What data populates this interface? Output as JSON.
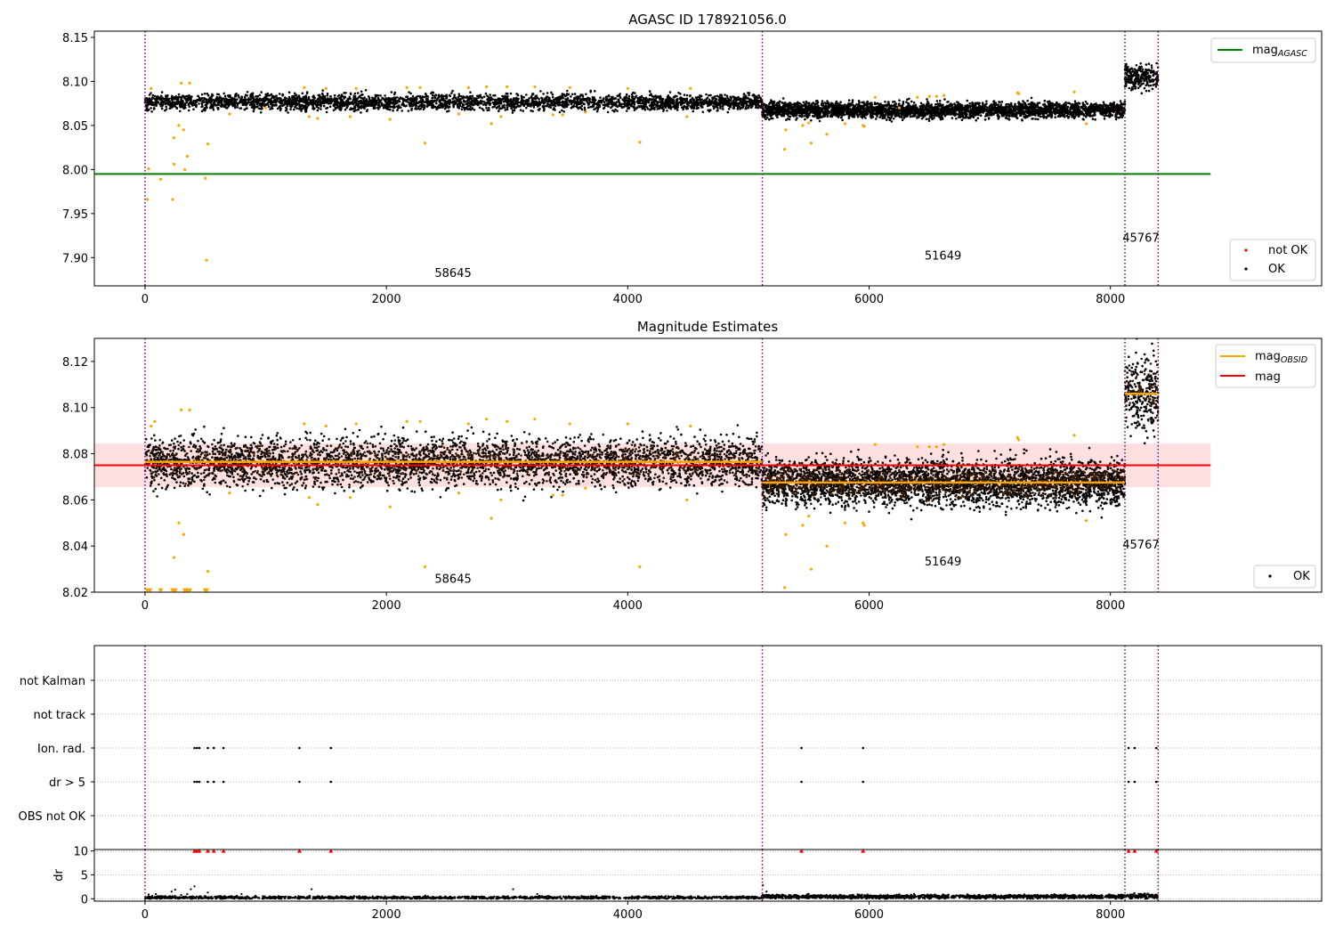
{
  "chart_data": [
    {
      "id": "agasc",
      "type": "scatter",
      "title": "AGASC ID 178921056.0",
      "xlim": [
        -420,
        9750
      ],
      "ylim": [
        7.868,
        8.157
      ],
      "xticks": [
        0,
        2000,
        4000,
        6000,
        8000
      ],
      "xtick_labels": [
        "0",
        "2000",
        "4000",
        "6000",
        "8000"
      ],
      "yticks": [
        7.9,
        7.95,
        8.0,
        8.05,
        8.1,
        8.15
      ],
      "ytick_labels": [
        "7.90",
        "7.95",
        "8.00",
        "8.05",
        "8.10",
        "8.15"
      ],
      "vlines": [
        0,
        5115,
        8120,
        8395
      ],
      "hline": {
        "y": 7.995,
        "x_range": [
          -420,
          8830
        ],
        "color": "#008000"
      },
      "obsid_labels": [
        {
          "text": "58645",
          "x": 2400,
          "y": 7.878
        },
        {
          "text": "51649",
          "x": 6460,
          "y": 7.898
        },
        {
          "text": "45767",
          "x": 8100,
          "y": 7.918
        }
      ],
      "segments": [
        {
          "x0": 0,
          "x1": 5115,
          "mean": 8.0765,
          "spread": 0.0045
        },
        {
          "x0": 5115,
          "x1": 8120,
          "mean": 8.0675,
          "spread": 0.0045
        },
        {
          "x0": 8120,
          "x1": 8395,
          "mean": 8.105,
          "spread": 0.007
        }
      ],
      "outliers": [
        [
          20,
          7.966
        ],
        [
          30,
          8.001
        ],
        [
          50,
          8.092
        ],
        [
          130,
          7.989
        ],
        [
          230,
          7.966
        ],
        [
          240,
          8.006
        ],
        [
          240,
          8.036
        ],
        [
          280,
          8.05
        ],
        [
          300,
          8.098
        ],
        [
          320,
          8.045
        ],
        [
          330,
          8.0
        ],
        [
          350,
          8.015
        ],
        [
          370,
          8.098
        ],
        [
          500,
          7.99
        ],
        [
          510,
          7.897
        ],
        [
          520,
          8.029
        ],
        [
          700,
          8.063
        ],
        [
          1000,
          8.07
        ],
        [
          1320,
          8.093
        ],
        [
          1360,
          8.06
        ],
        [
          1430,
          8.058
        ],
        [
          1500,
          8.092
        ],
        [
          1700,
          8.06
        ],
        [
          1750,
          8.092
        ],
        [
          2030,
          8.057
        ],
        [
          2170,
          8.093
        ],
        [
          2280,
          8.093
        ],
        [
          2320,
          8.03
        ],
        [
          2600,
          8.063
        ],
        [
          2680,
          8.093
        ],
        [
          2830,
          8.094
        ],
        [
          2870,
          8.052
        ],
        [
          2950,
          8.06
        ],
        [
          3000,
          8.094
        ],
        [
          3230,
          8.094
        ],
        [
          3380,
          8.062
        ],
        [
          3460,
          8.062
        ],
        [
          3520,
          8.093
        ],
        [
          3650,
          8.065
        ],
        [
          4000,
          8.092
        ],
        [
          4100,
          8.031
        ],
        [
          4490,
          8.06
        ],
        [
          4520,
          8.092
        ],
        [
          5300,
          8.023
        ],
        [
          5310,
          8.045
        ],
        [
          5450,
          8.05
        ],
        [
          5500,
          8.053
        ],
        [
          5520,
          8.03
        ],
        [
          5650,
          8.04
        ],
        [
          5800,
          8.052
        ],
        [
          5950,
          8.05
        ],
        [
          5960,
          8.049
        ],
        [
          6050,
          8.082
        ],
        [
          6250,
          8.07
        ],
        [
          6400,
          8.082
        ],
        [
          6500,
          8.083
        ],
        [
          6560,
          8.083
        ],
        [
          6620,
          8.084
        ],
        [
          7230,
          8.087
        ],
        [
          7240,
          8.086
        ],
        [
          7700,
          8.088
        ],
        [
          7800,
          8.052
        ]
      ],
      "legends": [
        {
          "position": "upper-right",
          "entries": [
            {
              "label": "mag",
              "subscript": "AGASC",
              "color": "#008000",
              "marker": "line"
            }
          ]
        },
        {
          "position": "lower-right",
          "entries": [
            {
              "label": "not OK",
              "color": "#ff0000",
              "marker": "dot"
            },
            {
              "label": "OK",
              "color": "#000000",
              "marker": "dot"
            }
          ]
        }
      ]
    },
    {
      "id": "estimates",
      "type": "scatter",
      "title": "Magnitude Estimates",
      "xlim": [
        -420,
        9750
      ],
      "ylim": [
        8.02,
        8.13
      ],
      "xticks": [
        0,
        2000,
        4000,
        6000,
        8000
      ],
      "xtick_labels": [
        "0",
        "2000",
        "4000",
        "6000",
        "8000"
      ],
      "yticks": [
        8.02,
        8.04,
        8.06,
        8.08,
        8.1,
        8.12
      ],
      "ytick_labels": [
        "8.02",
        "8.04",
        "8.06",
        "8.08",
        "8.10",
        "8.12"
      ],
      "vlines": [
        0,
        5115,
        8120,
        8395
      ],
      "band": {
        "y0": 8.0655,
        "y1": 8.0845,
        "x_range": [
          -420,
          8830
        ],
        "color": "#ffcccc"
      },
      "mean_line": {
        "y": 8.075,
        "x_range": [
          -420,
          8830
        ],
        "color": "#ff0000"
      },
      "obsid_means": [
        {
          "x0": 0,
          "x1": 5115,
          "y": 8.0765
        },
        {
          "x0": 5115,
          "x1": 8120,
          "y": 8.0675
        },
        {
          "x0": 8120,
          "x1": 8395,
          "y": 8.106
        }
      ],
      "obsid_labels": [
        {
          "text": "58645",
          "x": 2400,
          "y": 8.024
        },
        {
          "text": "51649",
          "x": 6460,
          "y": 8.0315
        },
        {
          "text": "45767",
          "x": 8100,
          "y": 8.039
        }
      ],
      "segments": [
        {
          "x0": 0,
          "x1": 5115,
          "mean": 8.0765,
          "spread": 0.0055
        },
        {
          "x0": 5115,
          "x1": 8120,
          "mean": 8.0675,
          "spread": 0.005
        },
        {
          "x0": 8120,
          "x1": 8395,
          "mean": 8.106,
          "spread": 0.008
        }
      ],
      "outliers": [
        [
          50,
          8.092
        ],
        [
          80,
          8.094
        ],
        [
          300,
          8.099
        ],
        [
          370,
          8.099
        ],
        [
          240,
          8.035
        ],
        [
          280,
          8.05
        ],
        [
          320,
          8.045
        ],
        [
          520,
          8.029
        ],
        [
          700,
          8.063
        ],
        [
          1320,
          8.093
        ],
        [
          1360,
          8.061
        ],
        [
          1430,
          8.058
        ],
        [
          1500,
          8.092
        ],
        [
          1700,
          8.061
        ],
        [
          1750,
          8.093
        ],
        [
          2030,
          8.057
        ],
        [
          2170,
          8.094
        ],
        [
          2280,
          8.094
        ],
        [
          2320,
          8.031
        ],
        [
          2600,
          8.063
        ],
        [
          2680,
          8.093
        ],
        [
          2830,
          8.095
        ],
        [
          2870,
          8.052
        ],
        [
          2950,
          8.06
        ],
        [
          3000,
          8.094
        ],
        [
          3230,
          8.095
        ],
        [
          3380,
          8.062
        ],
        [
          3460,
          8.062
        ],
        [
          3520,
          8.093
        ],
        [
          3650,
          8.065
        ],
        [
          4000,
          8.093
        ],
        [
          4100,
          8.031
        ],
        [
          4490,
          8.06
        ],
        [
          4520,
          8.092
        ],
        [
          5300,
          8.022
        ],
        [
          5310,
          8.045
        ],
        [
          5450,
          8.049
        ],
        [
          5500,
          8.053
        ],
        [
          5520,
          8.03
        ],
        [
          5650,
          8.04
        ],
        [
          5800,
          8.05
        ],
        [
          5950,
          8.05
        ],
        [
          5960,
          8.049
        ],
        [
          6050,
          8.084
        ],
        [
          6400,
          8.083
        ],
        [
          6500,
          8.083
        ],
        [
          6560,
          8.083
        ],
        [
          6620,
          8.084
        ],
        [
          7230,
          8.087
        ],
        [
          7240,
          8.086
        ],
        [
          7700,
          8.088
        ],
        [
          7800,
          8.051
        ]
      ],
      "floor_markers": [
        20,
        40,
        130,
        230,
        250,
        330,
        350,
        370,
        500,
        510
      ],
      "legends": [
        {
          "position": "upper-right",
          "entries": [
            {
              "label": "mag",
              "subscript": "OBSID",
              "color": "#ffa500",
              "marker": "line"
            },
            {
              "label": "mag",
              "subscript": "",
              "color": "#ff0000",
              "marker": "line"
            }
          ]
        },
        {
          "position": "lower-right",
          "entries": [
            {
              "label": "OK",
              "color": "#000000",
              "marker": "dot"
            }
          ]
        }
      ]
    },
    {
      "id": "flags",
      "type": "scatter",
      "xlim": [
        -420,
        9750
      ],
      "categories": [
        "not Kalman",
        "not track",
        "Ion. rad.",
        "dr > 5",
        "OBS not OK"
      ],
      "vlines": [
        0,
        5115,
        8120,
        8395
      ],
      "flag_points": {
        "Ion. rad.": [
          410,
          430,
          450,
          520,
          570,
          650,
          1280,
          1540,
          5440,
          5950,
          8150,
          8200,
          8380
        ],
        "dr > 5": [
          410,
          430,
          450,
          520,
          570,
          650,
          1280,
          1540,
          5440,
          5950,
          8150,
          8200,
          8380
        ]
      }
    },
    {
      "id": "dr",
      "type": "scatter",
      "ylabel": "dr",
      "xlim": [
        -420,
        9750
      ],
      "ylim": [
        -0.5,
        10.3
      ],
      "xticks": [
        0,
        2000,
        4000,
        6000,
        8000
      ],
      "xtick_labels": [
        "0",
        "2000",
        "4000",
        "6000",
        "8000"
      ],
      "yticks": [
        0,
        5,
        10
      ],
      "ytick_labels": [
        "0",
        "5",
        "10"
      ],
      "vlines": [
        0,
        5115,
        8120,
        8395
      ],
      "capped": [
        410,
        430,
        450,
        520,
        570,
        650,
        1280,
        1540,
        5440,
        5950,
        8150,
        8200,
        8380
      ],
      "cap_value": 10,
      "scatter_extra": [
        [
          30,
          0.9
        ],
        [
          60,
          0.6
        ],
        [
          90,
          1.0
        ],
        [
          150,
          0.4
        ],
        [
          220,
          1.5
        ],
        [
          250,
          1.9
        ],
        [
          300,
          0.8
        ],
        [
          350,
          1.0
        ],
        [
          380,
          2.0
        ],
        [
          410,
          2.6
        ],
        [
          450,
          0.5
        ],
        [
          520,
          1.3
        ],
        [
          700,
          0.3
        ],
        [
          800,
          1.0
        ],
        [
          1380,
          2.0
        ],
        [
          3050,
          2.0
        ],
        [
          3250,
          1.0
        ],
        [
          5120,
          2.8
        ],
        [
          5150,
          1.5
        ],
        [
          5600,
          0.8
        ],
        [
          6700,
          0.6
        ]
      ],
      "segments": [
        {
          "x0": 0,
          "x1": 5115,
          "mean": 0.25,
          "spread": 0.15
        },
        {
          "x0": 5115,
          "x1": 8120,
          "mean": 0.45,
          "spread": 0.2
        },
        {
          "x0": 8120,
          "x1": 8395,
          "mean": 0.6,
          "spread": 0.25
        }
      ]
    }
  ]
}
